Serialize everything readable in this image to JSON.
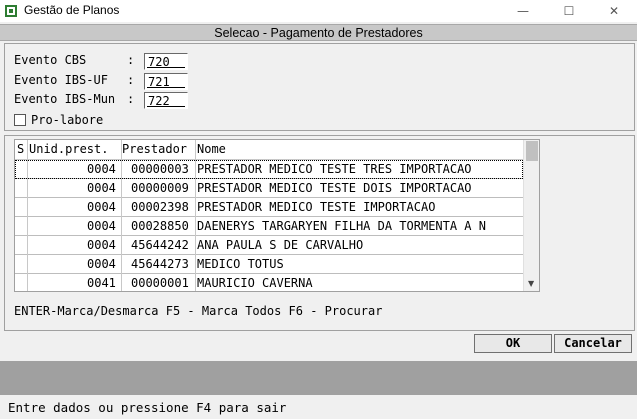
{
  "window": {
    "title": "Gestão de Planos",
    "minimize": "—",
    "maximize": "☐",
    "close": "✕",
    "icon": "app-icon"
  },
  "dialog": {
    "title": "Selecao - Pagamento de Prestadores"
  },
  "form": {
    "evento_cbs": {
      "label": "Evento CBS",
      "value": "720"
    },
    "evento_ibs_uf": {
      "label": "Evento IBS-UF",
      "value": "721"
    },
    "evento_ibs_mun": {
      "label": "Evento IBS-Mun",
      "value": "722"
    },
    "colon": ":",
    "pro_labore": {
      "label": "Pro-labore",
      "checked": false
    }
  },
  "grid": {
    "headers": [
      "S",
      "Unid.prest.",
      "Prestador",
      "Nome"
    ],
    "rows": [
      {
        "s": "",
        "unid": "0004",
        "prestador": "00000003",
        "nome": "PRESTADOR MEDICO TESTE TRES IMPORTACAO"
      },
      {
        "s": "",
        "unid": "0004",
        "prestador": "00000009",
        "nome": "PRESTADOR MEDICO TESTE DOIS IMPORTACAO"
      },
      {
        "s": "",
        "unid": "0004",
        "prestador": "00002398",
        "nome": "PRESTADOR MEDICO TESTE IMPORTACAO"
      },
      {
        "s": "",
        "unid": "0004",
        "prestador": "00028850",
        "nome": "DAENERYS TARGARYEN FILHA DA TORMENTA A N"
      },
      {
        "s": "",
        "unid": "0004",
        "prestador": "45644242",
        "nome": "ANA PAULA S DE CARVALHO"
      },
      {
        "s": "",
        "unid": "0004",
        "prestador": "45644273",
        "nome": "MEDICO TOTUS"
      },
      {
        "s": "",
        "unid": "0041",
        "prestador": "00000001",
        "nome": "MAURICIO CAVERNA"
      }
    ],
    "scroll_arrow": "▼"
  },
  "hint": "ENTER-Marca/Desmarca F5 - Marca Todos F6 - Procurar",
  "buttons": {
    "ok": "OK",
    "cancel": "Cancelar"
  },
  "status": "Entre dados ou pressione F4 para sair"
}
